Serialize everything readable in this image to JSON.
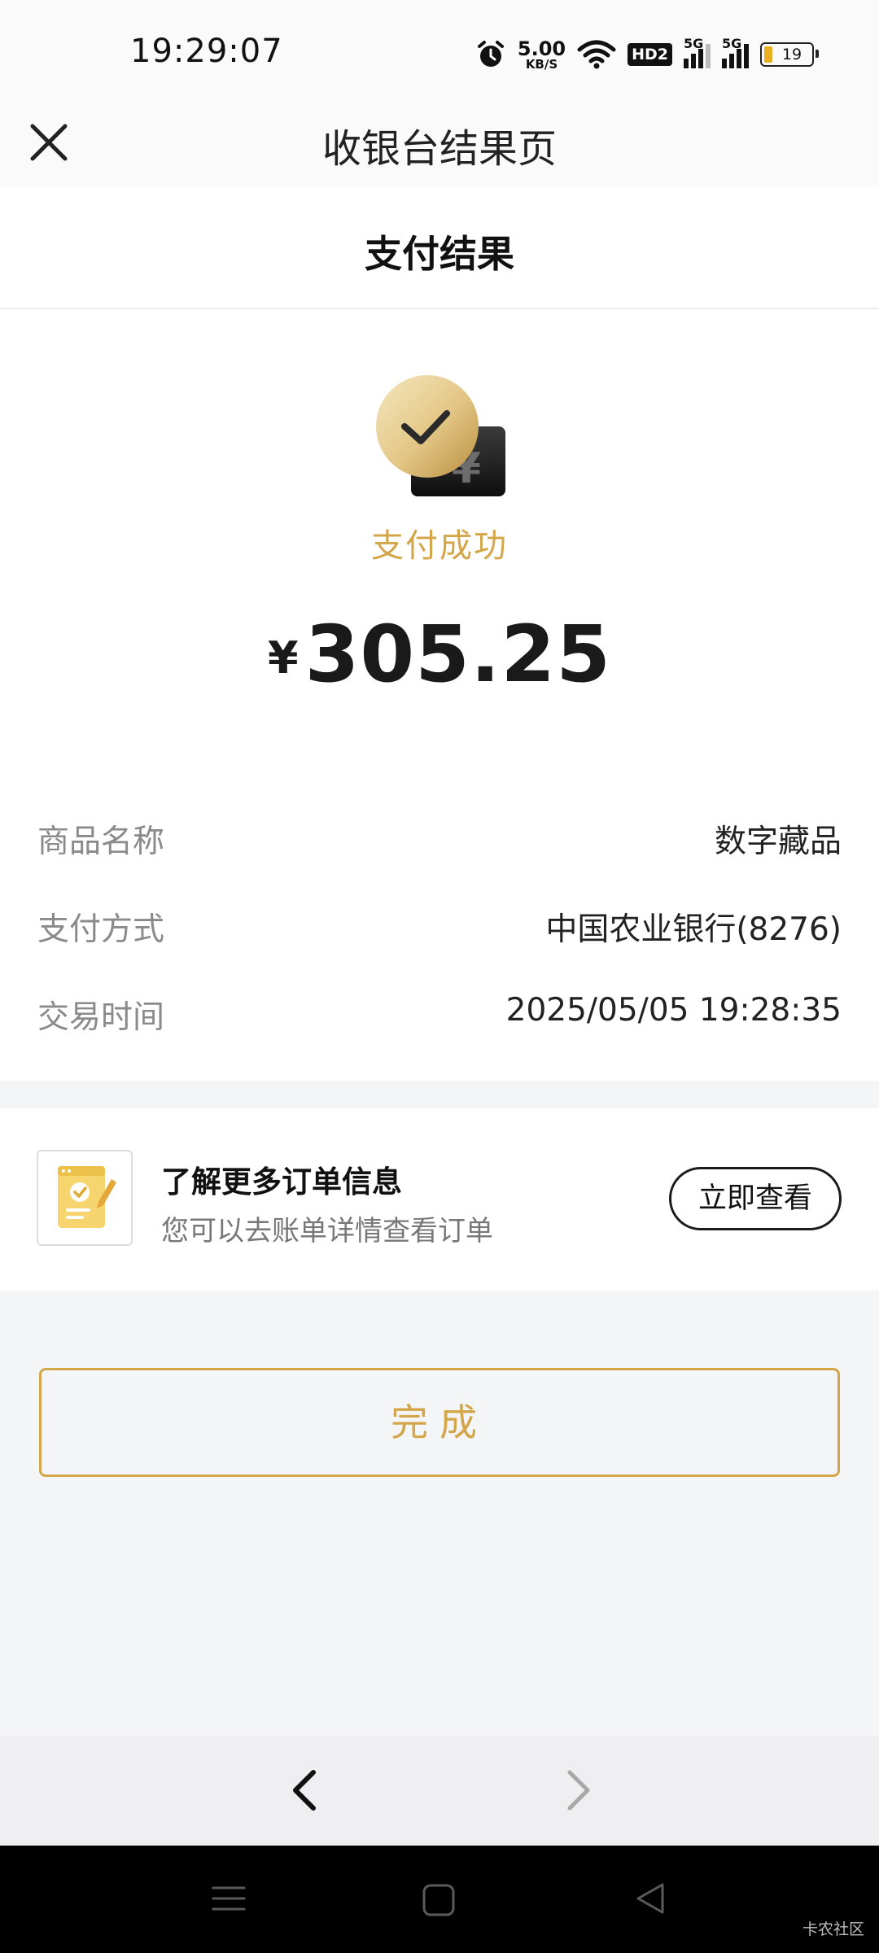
{
  "status_bar": {
    "time": "19:29:07",
    "net_speed": "5.00",
    "net_unit": "KB/S",
    "hd_label": "HD2",
    "signal1": "5G",
    "signal2": "5G",
    "battery": "19"
  },
  "nav": {
    "title": "收银台结果页"
  },
  "header": {
    "title": "支付结果"
  },
  "result": {
    "status": "支付成功",
    "currency": "¥",
    "amount": "305.25"
  },
  "details": [
    {
      "label": "商品名称",
      "value": "数字藏品"
    },
    {
      "label": "支付方式",
      "value": "中国农业银行(8276)"
    },
    {
      "label": "交易时间",
      "value": "2025/05/05 19:28:35"
    }
  ],
  "order_info": {
    "title": "了解更多订单信息",
    "subtitle": "您可以去账单详情查看订单",
    "button": "立即查看"
  },
  "done_button": "完成",
  "watermark": "卡农社区",
  "colors": {
    "accent_gold": "#d4a64a",
    "background": "#f4f5f7",
    "text_primary": "#1a1a1a"
  },
  "icons": [
    "close-icon",
    "success-check-icon",
    "wallet-yen-icon",
    "document-check-icon",
    "back-arrow-icon",
    "forward-arrow-icon",
    "menu-icon",
    "home-icon",
    "system-back-icon"
  ]
}
